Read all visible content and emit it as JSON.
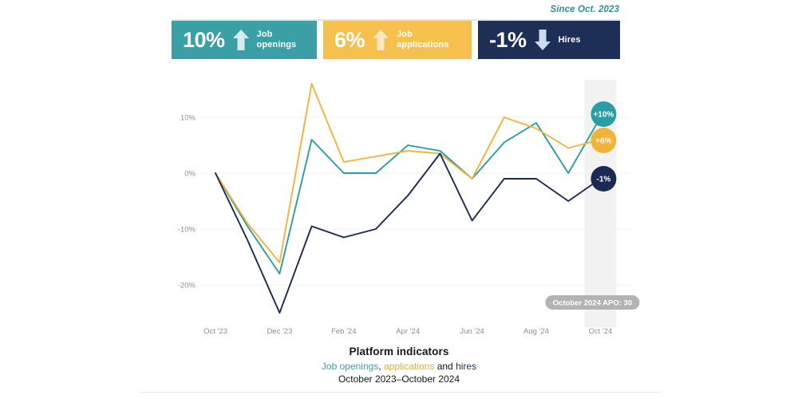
{
  "header": {
    "since_label": "Since Oct. 2023",
    "kpis": [
      {
        "id": "job-openings",
        "value": "10%",
        "direction": "up",
        "label_line1": "Job",
        "label_line2": "openings",
        "color": "#3aa0a6"
      },
      {
        "id": "job-applications",
        "value": "6%",
        "direction": "up",
        "label_line1": "Job",
        "label_line2": "applications",
        "color": "#f5c04e"
      },
      {
        "id": "hires",
        "value": "-1%",
        "direction": "down",
        "label_line1": "Hires",
        "label_line2": "",
        "color": "#1e2f57"
      }
    ]
  },
  "chart_data": {
    "type": "line",
    "title": "Platform indicators",
    "subtitle": "Job openings, applications and hires",
    "date_range": "October 2023–October 2024",
    "xlabel": "",
    "ylabel": "",
    "grid": true,
    "legend_position": "caption",
    "ylim": [
      -27,
      18
    ],
    "ytick_labels": [
      "10%",
      "0%",
      "-10%",
      "-20%"
    ],
    "ytick_values": [
      10,
      0,
      -10,
      -20
    ],
    "xtick_labels": [
      "Oct '23",
      "Dec '23",
      "Feb '24",
      "Apr '24",
      "Jun '24",
      "Aug '24",
      "Oct '24"
    ],
    "x": [
      "Oct '23",
      "Nov '23",
      "Dec '23",
      "Jan '24",
      "Feb '24",
      "Mar '24",
      "Apr '24",
      "May '24",
      "Jun '24",
      "Jul '24",
      "Aug '24",
      "Sep '24",
      "Oct '24"
    ],
    "series": [
      {
        "name": "Job openings",
        "color": "#2a9da4",
        "values": [
          0,
          -9.5,
          -18,
          6,
          0,
          0,
          5,
          4,
          -1,
          5.5,
          9,
          0,
          10
        ]
      },
      {
        "name": "Job applications",
        "color": "#f2b33d",
        "values": [
          0,
          -9,
          -16,
          16,
          2,
          3,
          4,
          3.5,
          -1,
          10,
          8,
          4.5,
          6
        ]
      },
      {
        "name": "Hires",
        "color": "#1b2a52",
        "values": [
          0,
          -12,
          -25,
          -9.5,
          -11.5,
          -10,
          -4,
          3.5,
          -8.5,
          -1,
          -1,
          -5,
          -1
        ]
      }
    ],
    "end_badges": [
      {
        "series": "Job openings",
        "text": "+10%",
        "color": "#2a9da4"
      },
      {
        "series": "Job applications",
        "text": "+6%",
        "color": "#f2b33d"
      },
      {
        "series": "Hires",
        "text": "-1%",
        "color": "#1b2a52"
      }
    ],
    "highlight_band": {
      "label": "Oct '24",
      "tooltip": "October 2024 APO: 30",
      "color": "#f2f2f2"
    },
    "tooltip_color": "#b3b3b3"
  },
  "caption": {
    "title": "Platform indicators",
    "seg_openings": "Job openings",
    "seg_comma": ", ",
    "seg_applications": "applications",
    "seg_and": " and ",
    "seg_hires": "hires",
    "dates": "October 2023–October 2024"
  }
}
